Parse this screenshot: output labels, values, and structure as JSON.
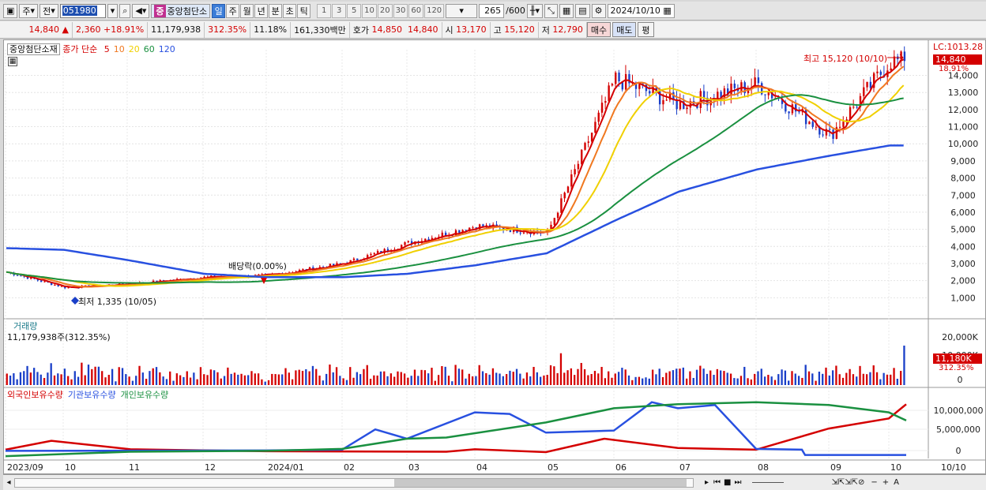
{
  "toolbar": {
    "type": "주",
    "adj": "전",
    "code": "051980",
    "name": "중앙첨단소",
    "badge": "중",
    "periods": [
      "일",
      "주",
      "월",
      "년",
      "분",
      "초",
      "틱"
    ],
    "ticks": [
      "1",
      "3",
      "5",
      "10",
      "20",
      "30",
      "60",
      "120"
    ],
    "count": "265",
    "max": "/600",
    "date": "2024/10/10"
  },
  "quote": {
    "price": "14,840",
    "arrow": "▲",
    "change": "2,360",
    "rate": "+18.91%",
    "volume": "11,179,938",
    "vol_ratio": "312.35%",
    "turnover": "11.18%",
    "amount": "161,330백만",
    "ask_label": "호가",
    "ask": "14,850",
    "bid": "14,840",
    "open_label": "시",
    "open": "13,170",
    "high_label": "고",
    "high": "15,120",
    "low_label": "저",
    "low": "12,790",
    "buy": "매수",
    "sell": "매도",
    "eval": "평"
  },
  "legend": {
    "name": "중앙첨단소재",
    "type": "종가 단순",
    "mas": [
      "5",
      "10",
      "20",
      "60",
      "120"
    ]
  },
  "ma_colors": [
    "#d40000",
    "#f07820",
    "#f0d000",
    "#1a9040",
    "#2850e0"
  ],
  "right_top": {
    "lc": "LC:1013.28",
    "price": "14,840",
    "rate": "18.91%"
  },
  "annot": {
    "high": "최고 15,120 (10/10)",
    "low": "최저 1,335 (10/05)",
    "div": "배당락(0.00%)"
  },
  "vol_panel": {
    "title": "거래량",
    "value": "11,179,938주(312.35%)",
    "last": "11,180K",
    "ratio": "312.35%"
  },
  "hold_panel": {
    "series": [
      "외국인보유수량",
      "기관보유수량",
      "개인보유수량"
    ],
    "colors": [
      "#d40000",
      "#2850e0",
      "#1a9040"
    ]
  },
  "price_axis": [
    "14,000",
    "13,000",
    "12,000",
    "11,000",
    "10,000",
    "9,000",
    "8,000",
    "7,000",
    "6,000",
    "5,000",
    "4,000",
    "3,000",
    "2,000",
    "1,000"
  ],
  "vol_axis": [
    "20,000K",
    "10,000K",
    "0"
  ],
  "hold_axis": [
    "10,000,000",
    "5,000,000",
    "0"
  ],
  "x_labels": [
    "2023/09",
    "10",
    "11",
    "12",
    "2024/01",
    "02",
    "03",
    "04",
    "05",
    "06",
    "07",
    "08",
    "09",
    "10"
  ],
  "x_last": "10/10",
  "chart_data": {
    "type": "line",
    "x": [
      "2023/09",
      "10",
      "11",
      "12",
      "2024/01",
      "02",
      "03",
      "04",
      "05",
      "06",
      "07",
      "08",
      "09",
      "2024/10/10"
    ],
    "series": [
      {
        "name": "중앙첨단소재",
        "values": [
          2500,
          1600,
          1800,
          2200,
          2300,
          3000,
          4200,
          5200,
          4800,
          13800,
          12300,
          13500,
          10500,
          14840
        ]
      },
      {
        "name": "120",
        "values": [
          3900,
          3800,
          3200,
          2400,
          2200,
          2200,
          2400,
          2900,
          3600,
          5500,
          7200,
          8500,
          9300,
          9900
        ]
      }
    ],
    "ylim": [
      0,
      15500
    ]
  }
}
